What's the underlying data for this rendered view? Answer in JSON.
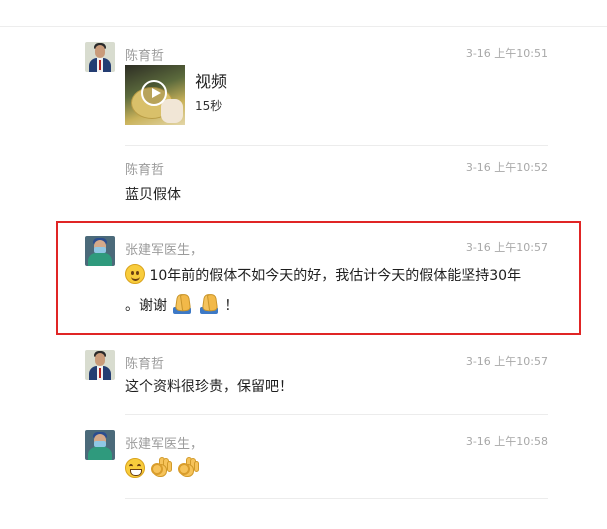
{
  "messages": [
    {
      "sender": "陈育哲",
      "time": "3-16 上午10:51",
      "avatar": "doctor-suit-avatar",
      "video": {
        "title": "视频",
        "duration": "15秒"
      }
    },
    {
      "sender": "陈育哲",
      "time": "3-16 上午10:52",
      "avatar": "doctor-suit-avatar",
      "text": "蓝贝假体"
    },
    {
      "sender": "张建军医生，",
      "time": "3-16 上午10:57",
      "avatar": "surgeon-avatar",
      "line1": "10年前的假体不如今天的好，我估计今天的假体能坚持30年",
      "line2_a": "。谢谢",
      "line2_b": "！",
      "emojis": [
        "smile-emoji",
        "pray-emoji",
        "pray-emoji"
      ],
      "highlighted": true,
      "highlight_color": "#e02525"
    },
    {
      "sender": "陈育哲",
      "time": "3-16 上午10:57",
      "avatar": "doctor-suit-avatar",
      "text": "这个资料很珍贵，保留吧！"
    },
    {
      "sender": "张建军医生，",
      "time": "3-16 上午10:58",
      "avatar": "surgeon-avatar",
      "emojis": [
        "grin-emoji",
        "ok-hand-emoji",
        "ok-hand-emoji"
      ]
    }
  ]
}
